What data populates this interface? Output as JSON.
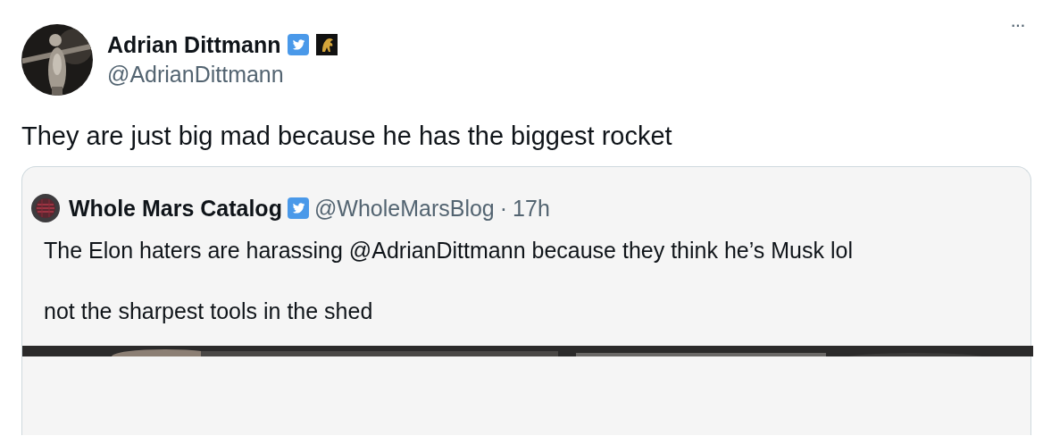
{
  "author": {
    "name": "Adrian Dittmann",
    "handle": "@AdrianDittmann",
    "verified": true
  },
  "more_button": "···",
  "text": "They are just big mad because he has the biggest rocket",
  "quoted": {
    "name": "Whole Mars Catalog",
    "verified": true,
    "handle": "@WholeMarsBlog",
    "separator": "·",
    "time": "17h",
    "paragraphs": [
      "The Elon haters are harassing @AdrianDittmann because they think he’s Musk lol",
      "not the sharpest tools in the shed"
    ]
  }
}
